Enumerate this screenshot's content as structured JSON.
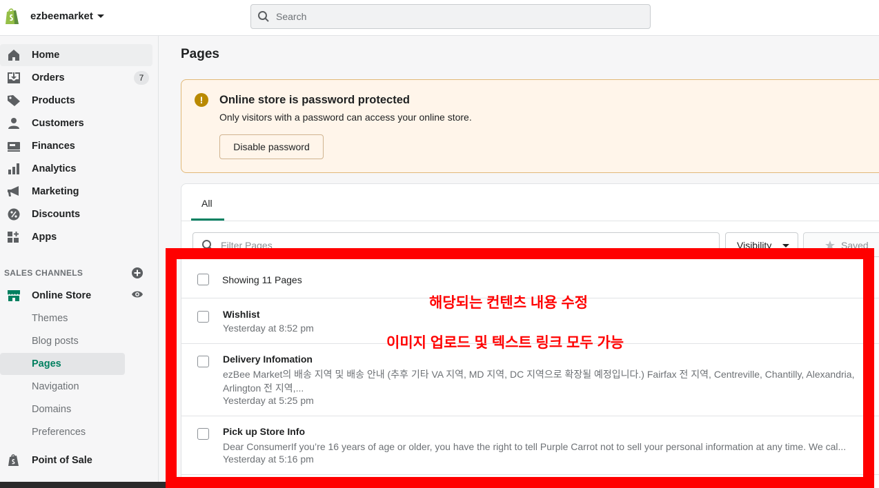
{
  "topbar": {
    "store_name": "ezbeemarket",
    "search_placeholder": "Search"
  },
  "sidebar": {
    "items": [
      {
        "label": "Home",
        "icon": "home-icon"
      },
      {
        "label": "Orders",
        "icon": "orders-icon",
        "badge": "7"
      },
      {
        "label": "Products",
        "icon": "tag-icon"
      },
      {
        "label": "Customers",
        "icon": "person-icon"
      },
      {
        "label": "Finances",
        "icon": "finances-icon"
      },
      {
        "label": "Analytics",
        "icon": "bar-chart-icon"
      },
      {
        "label": "Marketing",
        "icon": "megaphone-icon"
      },
      {
        "label": "Discounts",
        "icon": "discount-icon"
      },
      {
        "label": "Apps",
        "icon": "apps-icon"
      }
    ],
    "sales_channels_title": "SALES CHANNELS",
    "online_store": {
      "label": "Online Store",
      "sub_items": [
        "Themes",
        "Blog posts",
        "Pages",
        "Navigation",
        "Domains",
        "Preferences"
      ],
      "active_sub": "Pages"
    },
    "point_of_sale": "Point of Sale"
  },
  "main": {
    "title": "Pages",
    "banner": {
      "title": "Online store is password protected",
      "text": "Only visitors with a password can access your online store.",
      "button": "Disable password"
    },
    "tabs": [
      "All"
    ],
    "filter_placeholder": "Filter Pages",
    "visibility_label": "Visibility",
    "saved_label": "Saved",
    "showing": "Showing 11 Pages",
    "rows": [
      {
        "title": "Wishlist",
        "desc": "",
        "date": "Yesterday at 8:52 pm"
      },
      {
        "title": "Delivery Infomation",
        "desc": "ezBee Market의 배송 지역 및 배송 안내 (추후 기타 VA 지역, MD 지역, DC 지역으로 확장될 예정입니다.) Fairfax 전 지역, Centreville, Chantilly, Alexandria, Arlington 전 지역,...",
        "date": "Yesterday at 5:25 pm"
      },
      {
        "title": "Pick up Store Info",
        "desc": "Dear ConsumerIf you’re 16 years of age or older, you have the right to tell Purple Carrot not to sell your personal information at any time. We cal...",
        "date": "Yesterday at 5:16 pm"
      }
    ]
  },
  "annotation": {
    "line1": "해당되는 컨텐츠 내용 수정",
    "line2": "이미지 업로드 및 텍스트 링크 모두 가능",
    "color": "#ff0000"
  },
  "colors": {
    "accent_green": "#008060",
    "banner_bg": "#fff5ea",
    "warning_icon": "#b98900"
  }
}
